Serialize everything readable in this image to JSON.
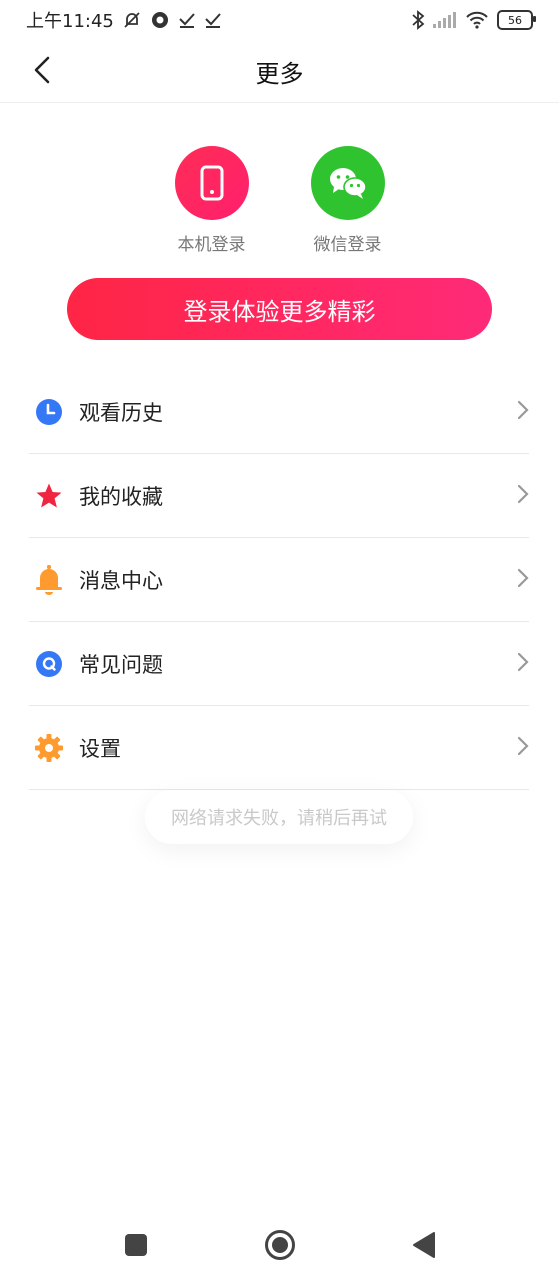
{
  "status_bar": {
    "time": "上午11:45",
    "battery": "56"
  },
  "header": {
    "title": "更多"
  },
  "login_options": [
    {
      "label": "本机登录",
      "icon": "phone-icon",
      "color": "#ff2d55"
    },
    {
      "label": "微信登录",
      "icon": "wechat-icon",
      "color": "#2fc42f"
    }
  ],
  "login_button": {
    "label": "登录体验更多精彩"
  },
  "menu": [
    {
      "label": "观看历史",
      "icon": "clock-icon",
      "color": "#3478f6"
    },
    {
      "label": "我的收藏",
      "icon": "star-icon",
      "color": "#f0253f"
    },
    {
      "label": "消息中心",
      "icon": "bell-icon",
      "color": "#ff9a2e"
    },
    {
      "label": "常见问题",
      "icon": "question-icon",
      "color": "#3478f6"
    },
    {
      "label": "设置",
      "icon": "gear-icon",
      "color": "#ff9a2e"
    }
  ],
  "toast": {
    "text": "网络请求失败，请稍后再试"
  }
}
